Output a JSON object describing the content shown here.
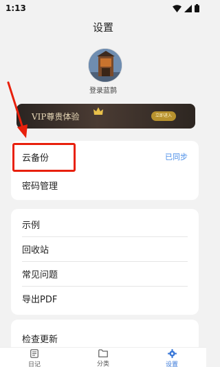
{
  "status_bar": {
    "time": "1:13"
  },
  "page": {
    "title": "设置"
  },
  "profile": {
    "login_label": "登录蓝鹊"
  },
  "vip": {
    "title": "VIP尊贵体验",
    "enter_label": "立即进入"
  },
  "sync_card": {
    "items": [
      {
        "label": "云备份",
        "status": "已同步"
      },
      {
        "label": "密码管理"
      }
    ]
  },
  "misc_card": {
    "items": [
      {
        "label": "示例"
      },
      {
        "label": "回收站"
      },
      {
        "label": "常见问题"
      },
      {
        "label": "导出PDF"
      }
    ]
  },
  "update_card": {
    "items": [
      {
        "label": "检查更新"
      }
    ]
  },
  "tabbar": {
    "tabs": [
      {
        "label": "日记",
        "icon": "diary-icon"
      },
      {
        "label": "分类",
        "icon": "folder-icon"
      },
      {
        "label": "设置",
        "icon": "gear-icon",
        "active": true
      }
    ]
  },
  "colors": {
    "accent": "#3a78d8",
    "sync_status": "#4a8ee8",
    "annotation": "#e8200c",
    "vip_gold": "#b8922e"
  }
}
